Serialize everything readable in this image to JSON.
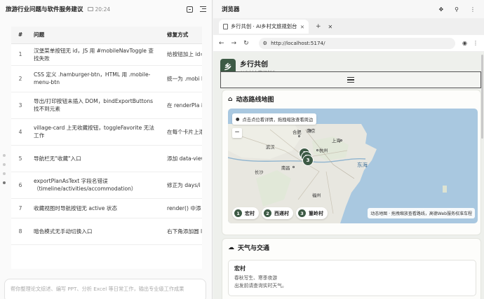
{
  "left_panel": {
    "title": "旅游行业问题与软件服务建议",
    "time": "20:24",
    "table": {
      "headers": [
        "#",
        "问题",
        "修复方式"
      ],
      "rows": [
        {
          "n": "1",
          "problem": "汉堡菜单按钮无 id，JS 用 #mobileNavToggle 查找失败",
          "fix": "给按钮加上 id=\"mobileN"
        },
        {
          "n": "2",
          "problem": "CSS 定义 .hamburger-btn，HTML 用 .mobile-menu-btn",
          "fix": "统一为 .mobi btn"
        },
        {
          "n": "3",
          "problem": "导出/打印按钮未插入 DOM，bindExportButtons 找不到元素",
          "fix": "在 renderPla insight-rail 中插"
        },
        {
          "n": "4",
          "problem": "village-card 上无收藏按钮，toggleFavorite 无法工作",
          "fix": "在每个卡片上添 并绑定事件"
        },
        {
          "n": "5",
          "problem": "导航栏无\"收藏\"入口",
          "fix": "添加 data-view=\"favor 按钮"
        },
        {
          "n": "6",
          "problem": "exportPlanAsText 字段名错误（timeline/activities/accommodation）",
          "fix": "修正为 days/i"
        },
        {
          "n": "7",
          "problem": "收藏视图时导航按钮无 active 状态",
          "fix": "render() 中添 link-btn 选择"
        },
        {
          "n": "8",
          "problem": "暗色模式无手动切换入口",
          "fix": "右下角添加圆 localStorage 记"
        }
      ]
    },
    "composer_placeholder": "帮你整理论文综述、编写 PPT、分析 Excel 等日常工作，输出专业级工作成果"
  },
  "browser": {
    "title": "浏览器",
    "tab_title": "乡行共创 · AI乡村文旅规划台",
    "url": "http://localhost:5174/",
    "site": {
      "logo_char": "乡",
      "name": "乡行共创",
      "subtitle": "AI乡村文旅规划台"
    },
    "map_section": {
      "title": "动态路线地图",
      "hint": "点击点位看详情，拖拽缩放查看周边",
      "zoom_out": "−",
      "cities": [
        "合肥",
        "南京",
        "上海",
        "武汉",
        "杭州",
        "长沙",
        "南昌",
        "福州"
      ],
      "sea_label": "东海",
      "stops": [
        {
          "n": "1",
          "name": "宏村"
        },
        {
          "n": "2",
          "name": "西递村"
        },
        {
          "n": "3",
          "name": "篁岭村"
        }
      ],
      "note": "动态地图 · 拖拽缩放查看路线，高德Web服务校准车程"
    },
    "weather_section": {
      "title": "天气与交通",
      "place": "宏村",
      "lines": [
        "春秋写生、寒季夜游",
        "出发前请查询实时天气。"
      ]
    }
  }
}
